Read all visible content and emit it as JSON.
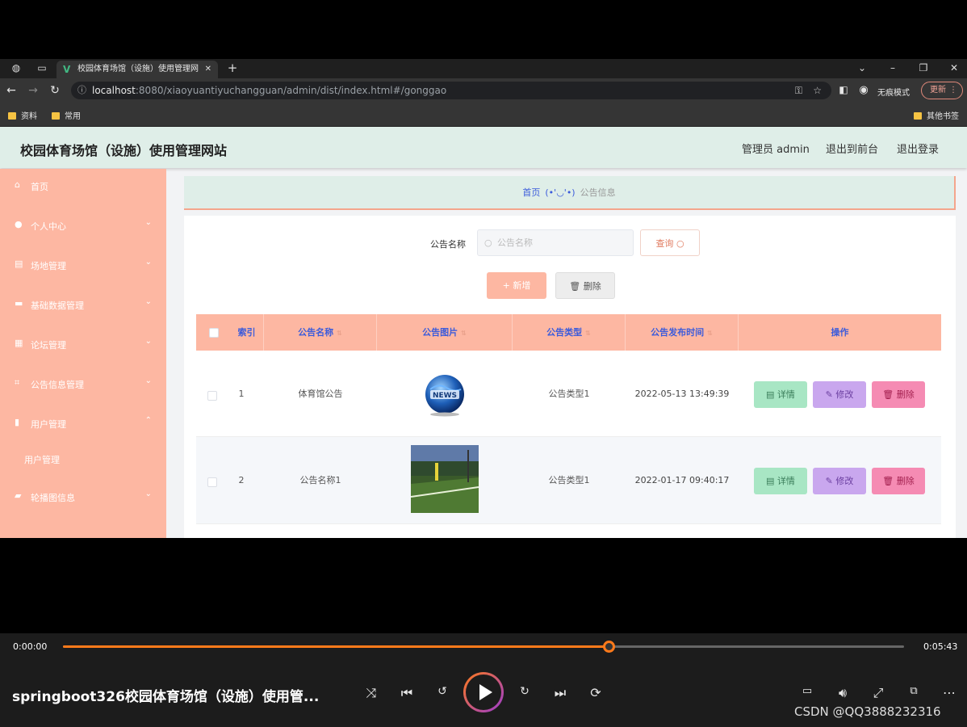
{
  "browser": {
    "tab_title": "校园体育场馆（设施）使用管理网",
    "url_host": "localhost",
    "url_rest": ":8080/xiaoyuantiyuchangguan/admin/dist/index.html#/gonggao",
    "incognito_label": "无痕模式",
    "update_label": "更新",
    "bookmarks": [
      "资料",
      "常用"
    ],
    "other_bookmarks": "其他书签"
  },
  "header": {
    "site_title": "校园体育场馆（设施）使用管理网站",
    "admin_label": "管理员 admin",
    "back_to_front": "退出到前台",
    "logout": "退出登录"
  },
  "sidebar": {
    "items": [
      {
        "label": "首页",
        "icon": "home-icon"
      },
      {
        "label": "个人中心",
        "icon": "user-icon"
      },
      {
        "label": "场地管理",
        "icon": "venue-icon"
      },
      {
        "label": "基础数据管理",
        "icon": "ticket-icon"
      },
      {
        "label": "论坛管理",
        "icon": "grid-icon"
      },
      {
        "label": "公告信息管理",
        "icon": "crop-icon"
      },
      {
        "label": "用户管理",
        "icon": "chart-icon"
      },
      {
        "label": "轮播图信息",
        "icon": "suitcase-icon"
      }
    ],
    "sub_item": "用户管理"
  },
  "breadcrumb": {
    "home": "首页",
    "face": "(•'◡'•)",
    "current": "公告信息"
  },
  "search": {
    "label": "公告名称",
    "placeholder": "公告名称",
    "query_button": "查询"
  },
  "toolbar": {
    "add_label": "+ 新增",
    "delete_label": "删除"
  },
  "table": {
    "columns": [
      "索引",
      "公告名称",
      "公告图片",
      "公告类型",
      "公告发布时间",
      "操作"
    ],
    "rows": [
      {
        "index": "1",
        "name": "体育馆公告",
        "image": "news-globe",
        "type": "公告类型1",
        "time": "2022-05-13 13:49:39"
      },
      {
        "index": "2",
        "name": "公告名称1",
        "image": "soccer-field",
        "type": "公告类型1",
        "time": "2022-01-17 09:40:17"
      }
    ],
    "actions": {
      "detail": "详情",
      "edit": "修改",
      "delete": "删除"
    }
  },
  "player": {
    "current_time": "0:00:00",
    "total_time": "0:05:43",
    "progress": 0.65,
    "title": "springboot326校园体育场馆（设施）使用管...",
    "watermark": "CSDN @QQ3888232316"
  },
  "colors": {
    "sidebar": "#fdb7a2",
    "header": "#dfeee8",
    "accent": "#ff7a1a"
  }
}
